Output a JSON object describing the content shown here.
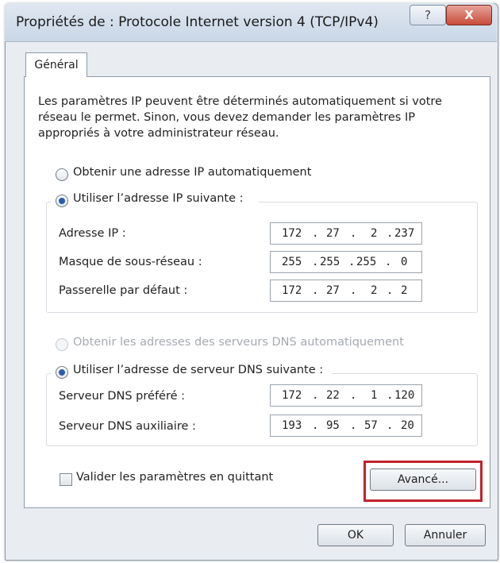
{
  "window": {
    "title": "Propriétés de : Protocole Internet version 4 (TCP/IPv4)",
    "help_glyph": "?",
    "close_glyph": "X"
  },
  "tab": {
    "label": "Général"
  },
  "intro_text": "Les paramètres IP peuvent être déterminés automatiquement si votre réseau le permet. Sinon, vous devez demander les paramètres IP appropriés à votre administrateur réseau.",
  "ip_options": {
    "auto_label": "Obtenir une adresse IP automatiquement",
    "manual_label": "Utiliser l’adresse IP suivante :",
    "selected": "manual"
  },
  "ip_fields": [
    {
      "label": "Adresse IP :",
      "octets": [
        "172",
        "27",
        "2",
        "237"
      ]
    },
    {
      "label": "Masque de sous-réseau :",
      "octets": [
        "255",
        "255",
        "255",
        "0"
      ]
    },
    {
      "label": "Passerelle par défaut :",
      "octets": [
        "172",
        "27",
        "2",
        "2"
      ]
    }
  ],
  "dns_options": {
    "auto_label": "Obtenir les adresses des serveurs DNS automatiquement",
    "manual_label": "Utiliser l’adresse de serveur DNS suivante :",
    "selected": "manual",
    "auto_disabled": true
  },
  "dns_fields": [
    {
      "label": "Serveur DNS préféré :",
      "octets": [
        "172",
        "22",
        "1",
        "120"
      ]
    },
    {
      "label": "Serveur DNS auxiliaire :",
      "octets": [
        "193",
        "95",
        "57",
        "20"
      ]
    }
  ],
  "validate_checkbox": {
    "label": "Valider les paramètres en quittant",
    "checked": false
  },
  "buttons": {
    "advanced": "Avancé...",
    "ok": "OK",
    "cancel": "Annuler"
  },
  "colors": {
    "highlight_border": "#c2222c",
    "radio_selected": "#2a5ea8",
    "close_button": "#c84b38"
  }
}
